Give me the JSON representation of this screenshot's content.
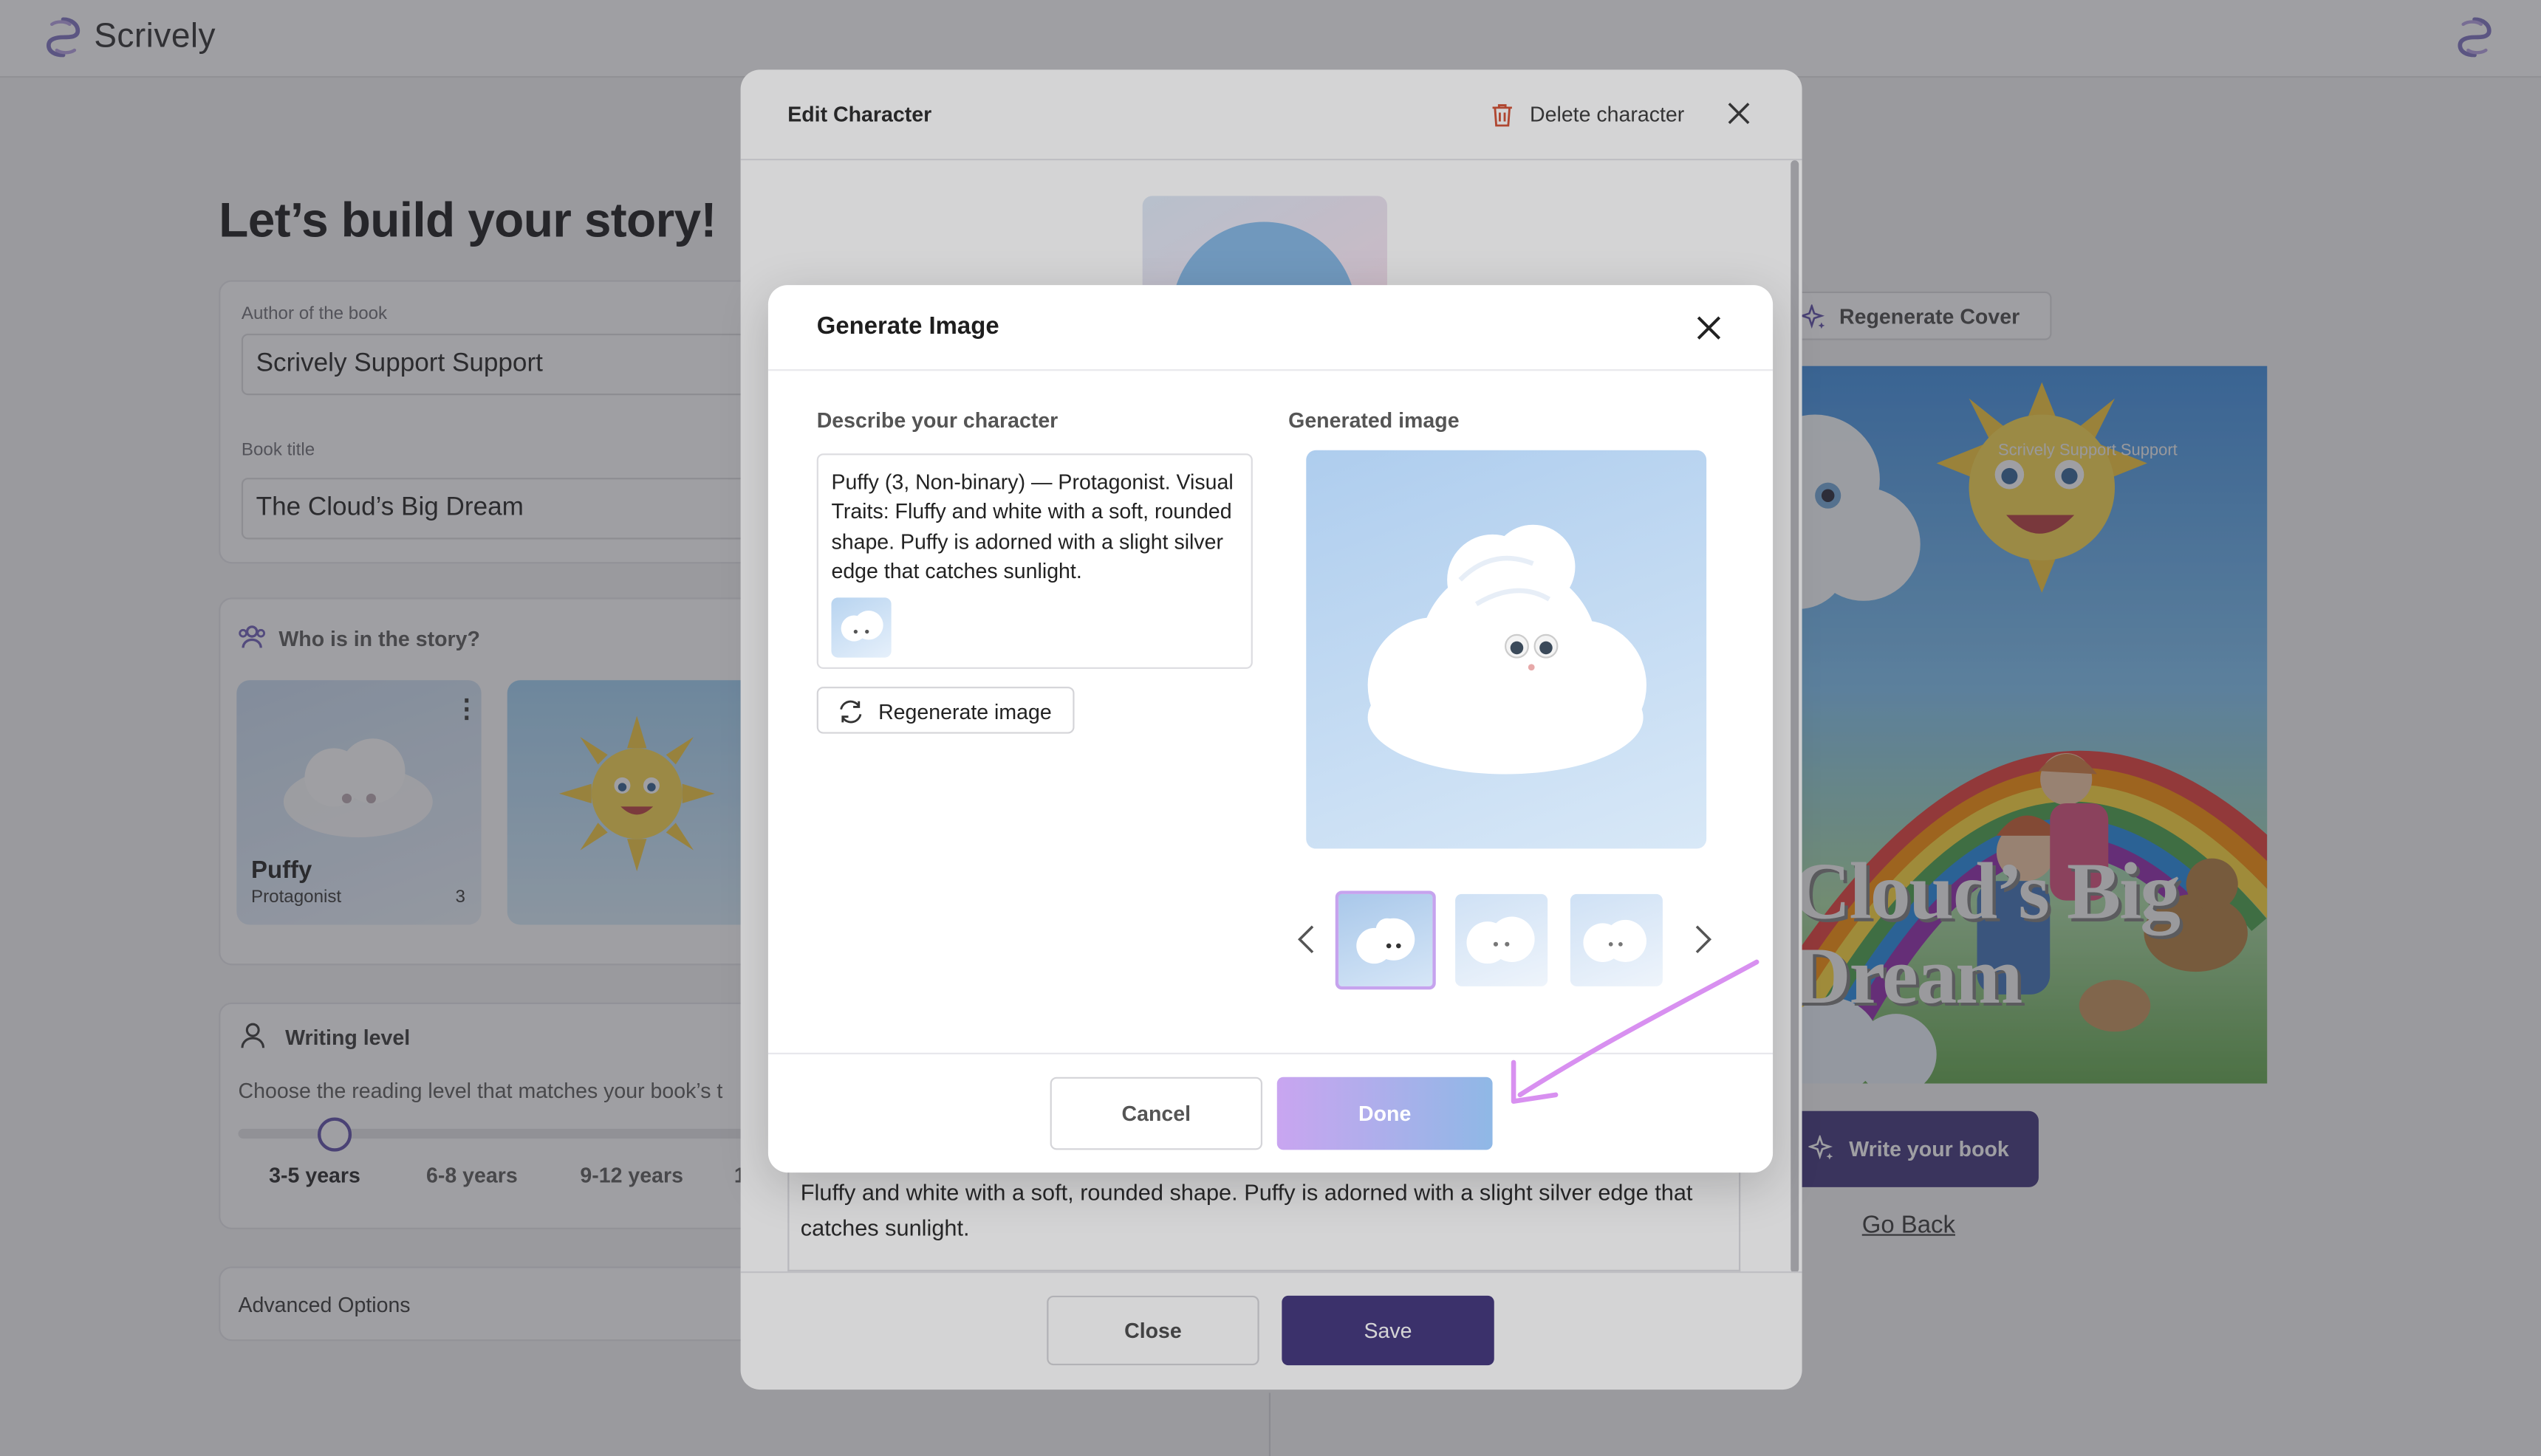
{
  "header": {
    "logo_text": "Scrively"
  },
  "page": {
    "heading": "Let’s build your story!",
    "author_label": "Author of the book",
    "author_value": "Scrively Support Support",
    "title_label": "Book title",
    "title_value": "The Cloud’s Big Dream",
    "characters_heading": "Who is in the story?",
    "character_cards": [
      {
        "name": "Puffy",
        "role": "Protagonist",
        "age": "3"
      }
    ],
    "writing_level_heading": "Writing level",
    "writing_level_desc": "Choose the reading level that matches your book’s t",
    "levels": [
      "3-5 years",
      "6-8 years",
      "9-12 years",
      "1"
    ],
    "advanced_options": "Advanced Options",
    "regenerate_cover": "Regenerate Cover",
    "cover_title_line1": "Cloud’s Big",
    "cover_title_line2": "Dream",
    "cover_author": "Scrively Support Support",
    "write_book": "Write your book",
    "go_back": "Go Back"
  },
  "edit_modal": {
    "title": "Edit Character",
    "delete_label": "Delete character",
    "description_text": "Fluffy and white with a soft, rounded shape. Puffy is adorned with a slight silver edge that catches sunlight.",
    "close_label": "Close",
    "save_label": "Save"
  },
  "generate_modal": {
    "title": "Generate Image",
    "describe_label": "Describe your character",
    "description": "Puffy (3, Non-binary) — Protagonist. Visual Traits: Fluffy and white with a soft, rounded shape. Puffy is adorned with a slight silver edge that catches sunlight.",
    "regenerate_label": "Regenerate image",
    "generated_label": "Generated image",
    "cancel_label": "Cancel",
    "done_label": "Done"
  },
  "colors": {
    "brand": "#3b2f78",
    "accent_gradient_start": "#c9a5f0",
    "accent_gradient_end": "#8fb8e6",
    "annotation": "#d890f0"
  },
  "writing_level_value": "3-5 years"
}
